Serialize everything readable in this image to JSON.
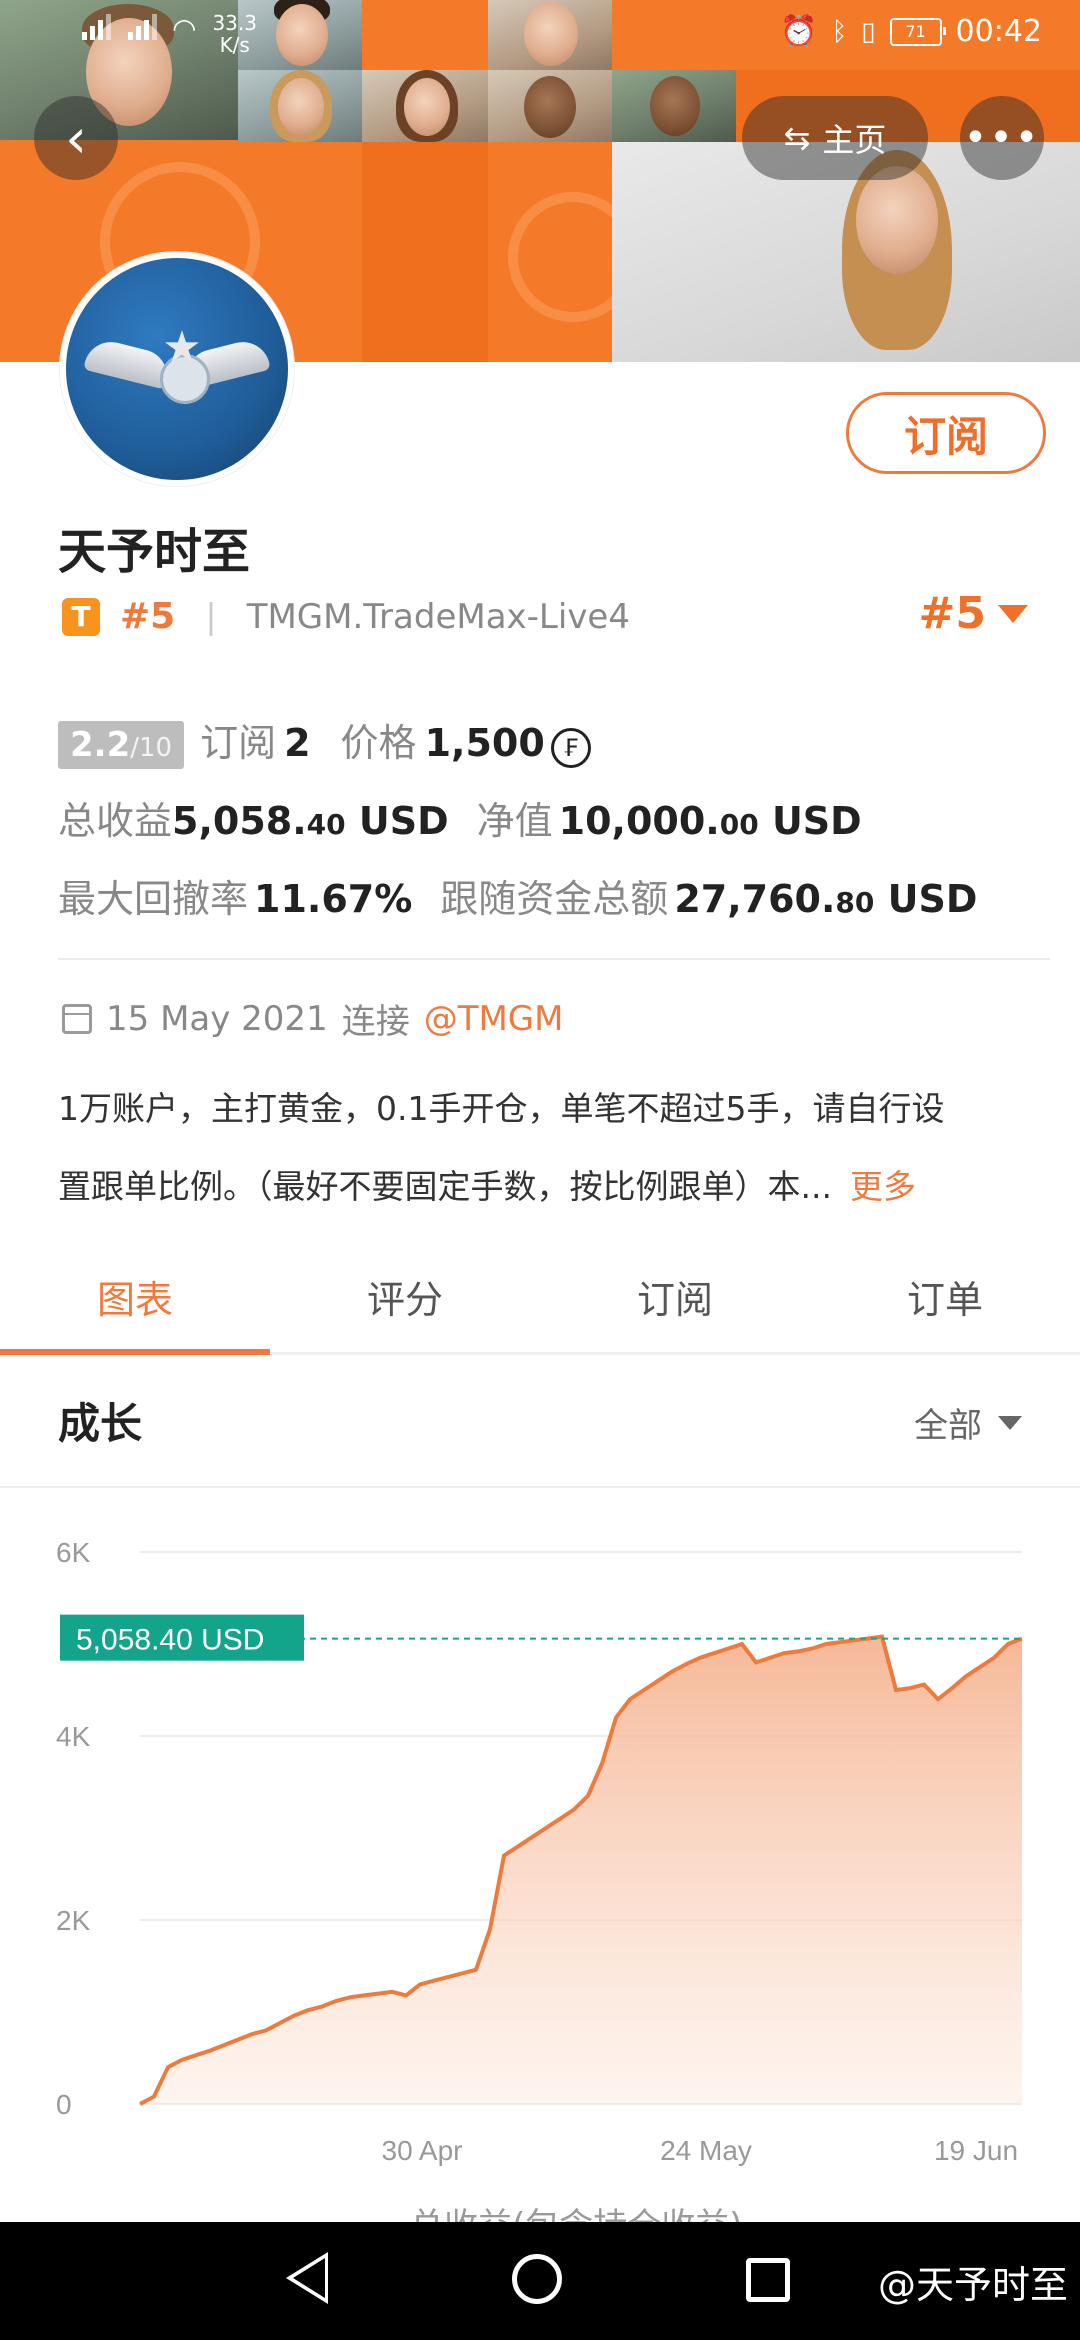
{
  "status_bar": {
    "net_speed_value": "33.3",
    "net_speed_unit": "K/s",
    "battery": "71",
    "time": "00:42"
  },
  "header": {
    "home_label": "主页"
  },
  "profile": {
    "name": "天予时至",
    "subscribe_label": "订阅",
    "badge": "T",
    "rank": "#5",
    "server": "TMGM.TradeMax-Live4",
    "rank_right": "#5"
  },
  "stats": {
    "score": "2.2",
    "score_max": "/10",
    "subscribers_label": "订阅",
    "subscribers": "2",
    "price_label": "价格",
    "price": "1,500",
    "price_icon": "₣",
    "total_profit_label": "总收益",
    "total_profit_int": "5,058.",
    "total_profit_dec": "40",
    "total_profit_unit": "USD",
    "net_value_label": "净值",
    "net_value_int": "10,000.",
    "net_value_dec": "00",
    "net_value_unit": "USD",
    "max_drawdown_label": "最大回撤率",
    "max_drawdown": "11.67%",
    "follow_funds_label": "跟随资金总额",
    "follow_funds_int": "27,760.",
    "follow_funds_dec": "80",
    "follow_funds_unit": "USD"
  },
  "connection": {
    "date": "15 May 2021",
    "connect_label": "连接",
    "broker": "@TMGM"
  },
  "description": {
    "line1": "1万账户，主打黄金，0.1手开仓，单笔不超过5手，请自行设",
    "line2": "置跟单比例。（最好不要固定手数，按比例跟单）本...",
    "more_label": "更多"
  },
  "tabs": [
    {
      "label": "图表",
      "active": true
    },
    {
      "label": "评分",
      "active": false
    },
    {
      "label": "订阅",
      "active": false
    },
    {
      "label": "订单",
      "active": false
    }
  ],
  "growth": {
    "title": "成长",
    "filter": "全部"
  },
  "chart_data": {
    "type": "area",
    "title": "",
    "xlabel": "",
    "ylabel": "",
    "y_ticks": [
      "0",
      "2K",
      "4K",
      "6K"
    ],
    "ylim": [
      0,
      6000
    ],
    "x_ticks": [
      "30 Apr",
      "24 May",
      "19 Jun"
    ],
    "current_value_label": "5,058.40 USD",
    "current_value": 5058.4,
    "color": "#ef7a3c",
    "label_color": "#13a58c",
    "values": [
      0,
      80,
      400,
      480,
      530,
      580,
      640,
      700,
      760,
      800,
      880,
      960,
      1020,
      1060,
      1120,
      1160,
      1180,
      1200,
      1220,
      1180,
      1300,
      1340,
      1380,
      1420,
      1460,
      1900,
      2700,
      2800,
      2900,
      3000,
      3100,
      3200,
      3350,
      3700,
      4200,
      4400,
      4500,
      4600,
      4700,
      4780,
      4850,
      4900,
      4950,
      5000,
      4800,
      4850,
      4900,
      4920,
      4950,
      5000,
      5020,
      5040,
      5060,
      5080,
      4500,
      4520,
      4560,
      4400,
      4520,
      4650,
      4750,
      4850,
      5000,
      5058.4
    ]
  },
  "footer": {
    "cut_text": "总收益(包含持仓收益)",
    "watermark": "@天予时至"
  }
}
